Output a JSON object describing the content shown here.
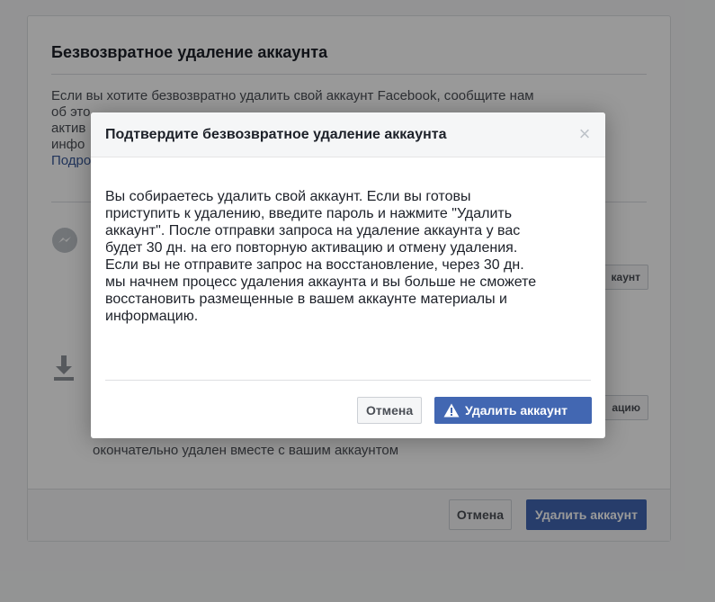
{
  "panel": {
    "title": "Безвозвратное удаление аккаунта",
    "intro_lines": [
      "Если вы хотите безвозвратно удалить свой аккаунт Facebook, сообщите нам",
      "об это",
      "актив",
      "инфо"
    ],
    "intro_link": "Подро",
    "side_button_1": "каунт",
    "side_button_2": "ацию",
    "footnote": "окончательно удален вместе с вашим аккаунтом",
    "footer": {
      "cancel_label": "Отмена",
      "delete_label": "Удалить аккаунт"
    },
    "icons": {
      "messenger": "messenger-icon",
      "download": "download-icon"
    }
  },
  "modal": {
    "title": "Подтвердите безвозвратное удаление аккаунта",
    "close_glyph": "×",
    "body_lines": [
      "Вы собираетесь удалить свой аккаунт. Если вы готовы",
      "приступить к удалению, введите пароль и нажмите \"Удалить",
      "аккаунт\". После отправки запроса на удаление аккаунта у вас",
      "будет 30 дн. на его повторную активацию и отмену удаления.",
      "Если вы не отправите запрос на восстановление, через 30 дн.",
      "мы начнем процесс удаления аккаунта и вы больше не сможете",
      "восстановить размещенные в вашем аккаунте материалы и",
      "информацию."
    ],
    "cancel_label": "Отмена",
    "delete_label": "Удалить аккаунт",
    "warning_icon": "warning-icon"
  },
  "colors": {
    "primary": "#4267b2",
    "link": "#385898",
    "overlay": "rgba(0,0,0,0.4)"
  }
}
